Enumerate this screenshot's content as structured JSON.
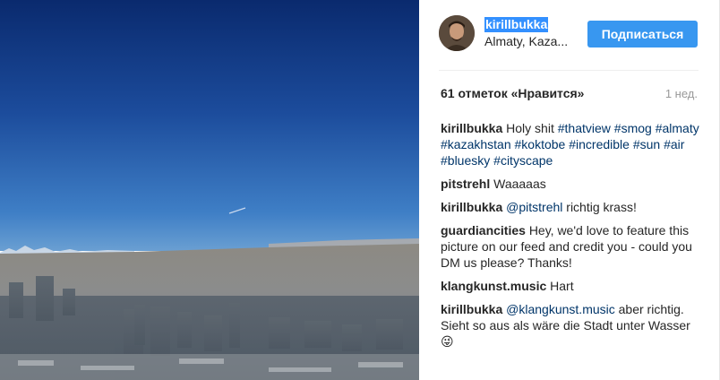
{
  "post": {
    "username": "kirillbukka",
    "location": "Almaty, Kaza...",
    "follow_label": "Подписаться",
    "likes": "61 отметок «Нравится»",
    "time": "1 нед."
  },
  "comments": [
    {
      "author": "kirillbukka",
      "parts": [
        {
          "text": "Holy shit ",
          "tag": false
        },
        {
          "text": "#thatview",
          "tag": true
        },
        {
          "text": " ",
          "tag": false
        },
        {
          "text": "#smog",
          "tag": true
        },
        {
          "text": " ",
          "tag": false
        },
        {
          "text": "#almaty",
          "tag": true
        },
        {
          "text": " ",
          "tag": false
        },
        {
          "text": "#kazakhstan",
          "tag": true
        },
        {
          "text": " ",
          "tag": false
        },
        {
          "text": "#koktobe",
          "tag": true
        },
        {
          "text": " ",
          "tag": false
        },
        {
          "text": "#incredible",
          "tag": true
        },
        {
          "text": " ",
          "tag": false
        },
        {
          "text": "#sun",
          "tag": true
        },
        {
          "text": " ",
          "tag": false
        },
        {
          "text": "#air",
          "tag": true
        },
        {
          "text": " ",
          "tag": false
        },
        {
          "text": "#bluesky",
          "tag": true
        },
        {
          "text": " ",
          "tag": false
        },
        {
          "text": "#cityscape",
          "tag": true
        }
      ]
    },
    {
      "author": "pitstrehl",
      "parts": [
        {
          "text": "Waaaaas",
          "tag": false
        }
      ]
    },
    {
      "author": "kirillbukka",
      "parts": [
        {
          "text": "@pitstrehl",
          "tag": true
        },
        {
          "text": " richtig krass!",
          "tag": false
        }
      ]
    },
    {
      "author": "guardiancities",
      "parts": [
        {
          "text": "Hey, we'd love to feature this picture on our feed and credit you - could you DM us please? Thanks!",
          "tag": false
        }
      ]
    },
    {
      "author": "klangkunst.music",
      "parts": [
        {
          "text": "Hart",
          "tag": false
        }
      ]
    },
    {
      "author": "kirillbukka",
      "parts": [
        {
          "text": "@klangkunst.music",
          "tag": true
        },
        {
          "text": " aber richtig. Sieht so aus als wäre die Stadt unter Wasser 😜",
          "tag": false
        }
      ]
    }
  ],
  "colors": {
    "accent": "#3897f0",
    "link": "#003569"
  }
}
